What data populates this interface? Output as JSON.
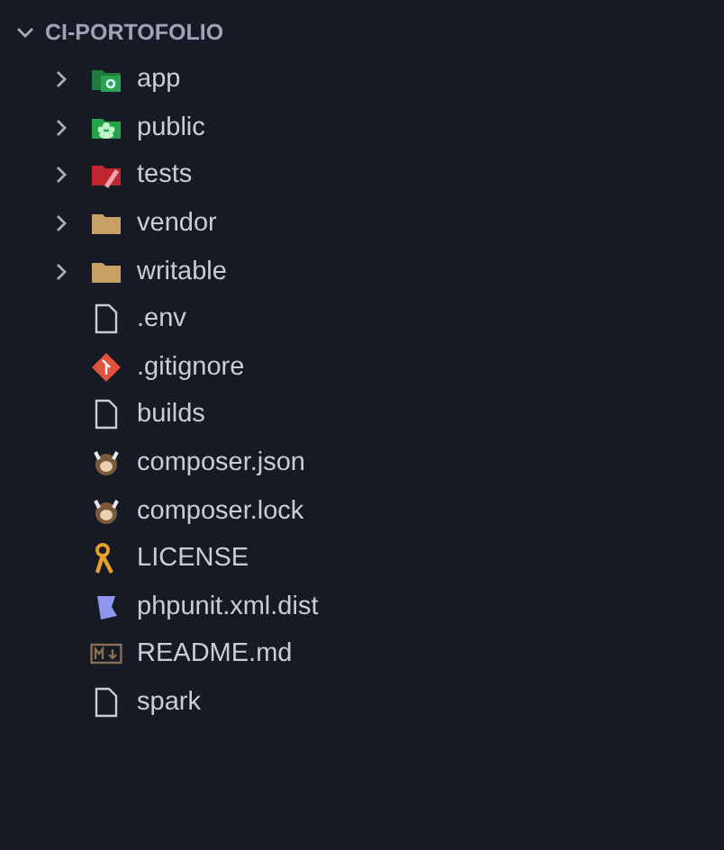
{
  "explorer": {
    "title": "CI-PORTOFOLIO",
    "expanded": true,
    "items": [
      {
        "name": "app",
        "kind": "appfolder",
        "expanded": false
      },
      {
        "name": "public",
        "kind": "publicfolder",
        "expanded": false
      },
      {
        "name": "tests",
        "kind": "testfolder",
        "expanded": false
      },
      {
        "name": "vendor",
        "kind": "folder",
        "expanded": false
      },
      {
        "name": "writable",
        "kind": "folder",
        "expanded": false
      },
      {
        "name": ".env",
        "kind": "file"
      },
      {
        "name": ".gitignore",
        "kind": "git"
      },
      {
        "name": "builds",
        "kind": "file"
      },
      {
        "name": "composer.json",
        "kind": "composer"
      },
      {
        "name": "composer.lock",
        "kind": "composer"
      },
      {
        "name": "LICENSE",
        "kind": "license"
      },
      {
        "name": "phpunit.xml.dist",
        "kind": "phpunit"
      },
      {
        "name": "README.md",
        "kind": "markdown"
      },
      {
        "name": "spark",
        "kind": "file"
      }
    ]
  }
}
